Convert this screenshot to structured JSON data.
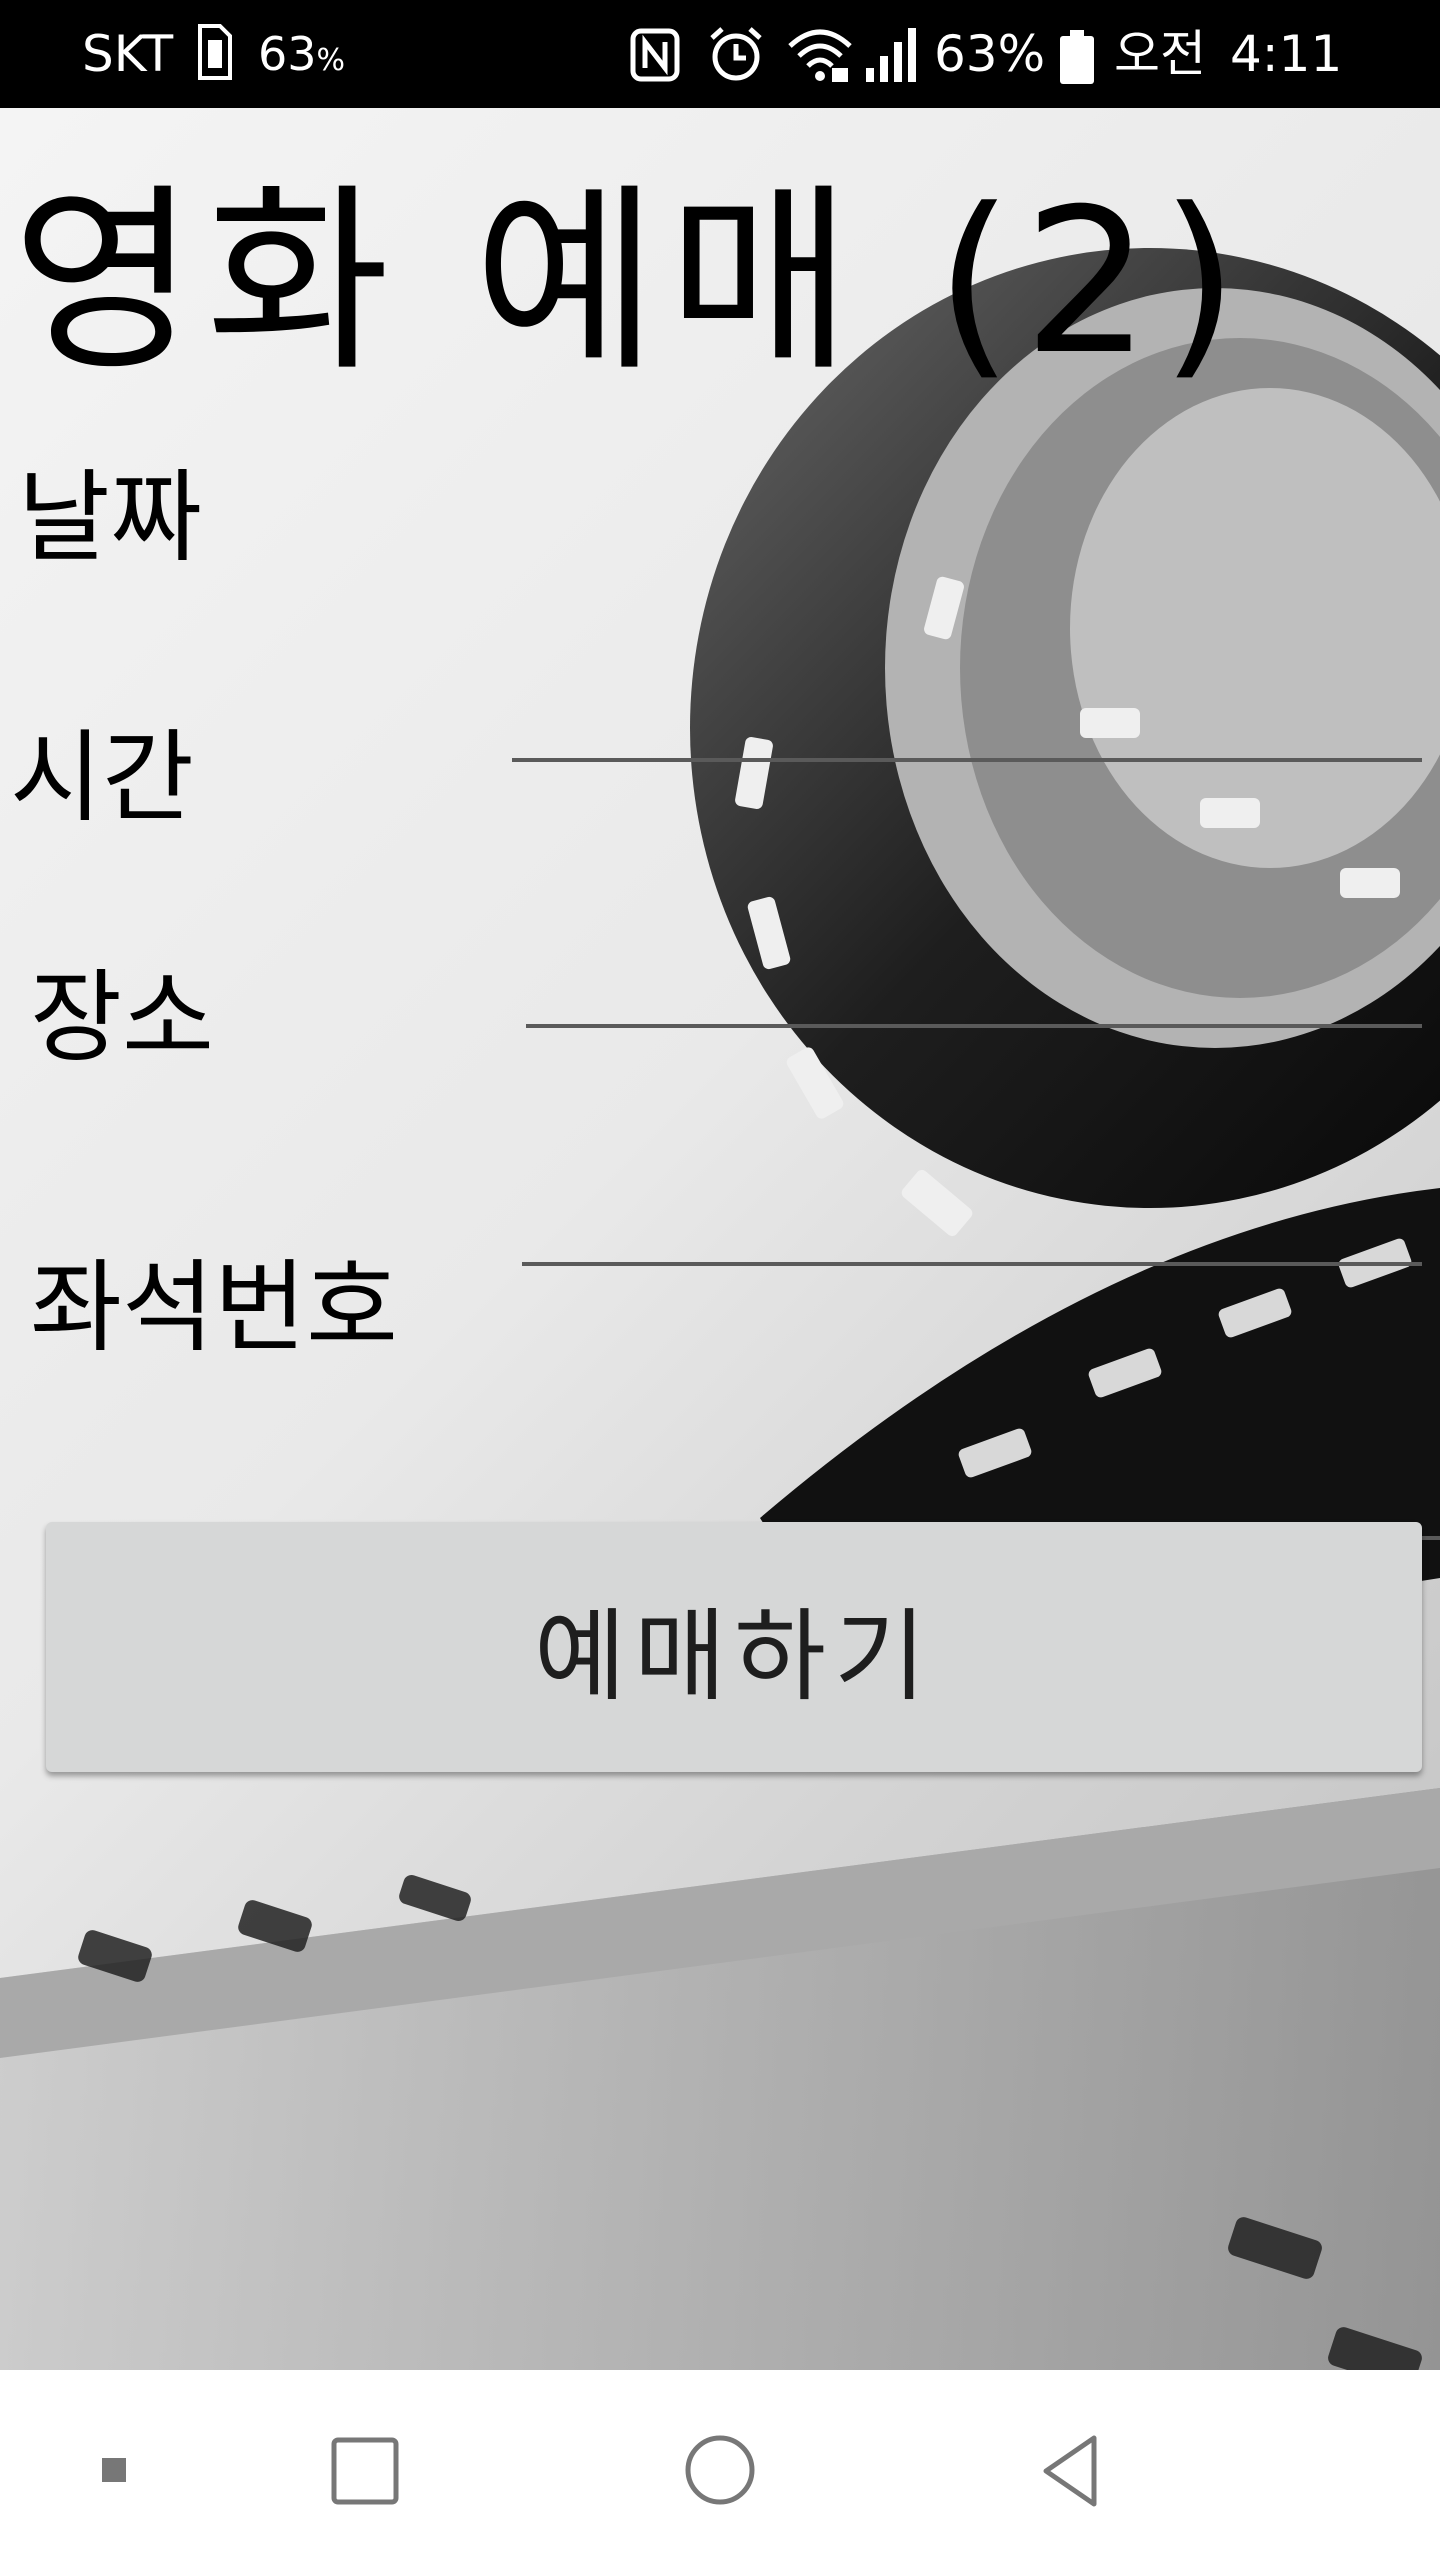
{
  "status_bar": {
    "carrier": "SKT",
    "left_battery_value": "63",
    "left_battery_unit": "%",
    "icons": [
      "sim-card-icon",
      "nfc-icon",
      "alarm-icon",
      "wifi-icon",
      "cell-signal-icon",
      "battery-icon"
    ],
    "battery_percent": "63%",
    "ampm": "오전",
    "time": "4:11"
  },
  "page": {
    "title": "영화 예매 (2)",
    "fields": {
      "date_label": "날짜",
      "time_label": "시간",
      "place_label": "장소",
      "seat_label": "좌석번호"
    },
    "inputs": {
      "date_value": "",
      "time_value": "",
      "place_value": "",
      "seat_value": ""
    },
    "reserve_button": "예매하기"
  },
  "navigation_bar": {
    "icons": [
      "dot-icon",
      "recent-apps-icon",
      "home-icon",
      "back-icon"
    ]
  },
  "colors": {
    "status_bar_bg": "#000000",
    "button_bg": "#d6d7d7",
    "underline": "#5a5a5a"
  }
}
